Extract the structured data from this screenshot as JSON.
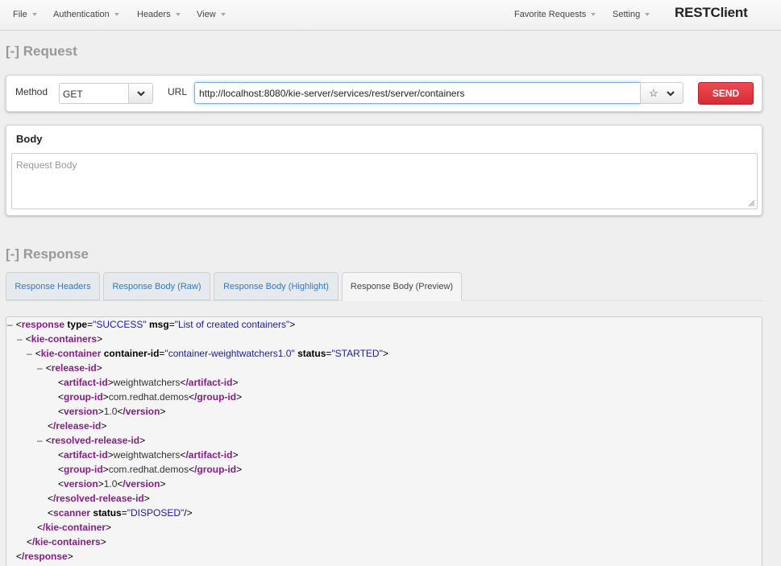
{
  "navbar": {
    "file": "File",
    "authentication": "Authentication",
    "headers": "Headers",
    "view": "View",
    "favorite_requests": "Favorite Requests",
    "setting": "Setting",
    "brand": "RESTClient"
  },
  "request": {
    "section_title": "[-] Request",
    "method_label": "Method",
    "method_value": "GET",
    "url_label": "URL",
    "url_value": "http://localhost:8080/kie-server/services/rest/server/containers",
    "send_label": "SEND",
    "star_icon": "star-icon",
    "body_title": "Body",
    "body_placeholder": "Request Body"
  },
  "response": {
    "section_title": "[-] Response",
    "tabs": [
      {
        "label": "Response Headers",
        "active": false
      },
      {
        "label": "Response Body (Raw)",
        "active": false
      },
      {
        "label": "Response Body (Highlight)",
        "active": false
      },
      {
        "label": "Response Body (Preview)",
        "active": true
      }
    ],
    "xml": {
      "toggle": "–",
      "response_tag": "response",
      "response_close": "/response",
      "type_attr": "type",
      "type_val": "\"SUCCESS\"",
      "msg_attr": "msg",
      "msg_val": "\"List of created containers\"",
      "kie_containers": "kie-containers",
      "kie_containers_close": "/kie-containers",
      "kie_container": "kie-container",
      "kie_container_close": "/kie-container",
      "container_id_attr": "container-id",
      "container_id_val": "\"container-weightwatchers1.0\"",
      "status_attr": "status",
      "status_val": "\"STARTED\"",
      "release_id": "release-id",
      "release_id_close": "/release-id",
      "resolved_release_id": "resolved-release-id",
      "resolved_release_id_close": "/resolved-release-id",
      "artifact_id": "artifact-id",
      "artifact_id_close": "/artifact-id",
      "artifact_value": "weightwatchers",
      "group_id": "group-id",
      "group_id_close": "/group-id",
      "group_value": "com.redhat.demos",
      "version": "version",
      "version_close": "/version",
      "version_value": "1.0",
      "scanner": "scanner",
      "scanner_status_val": "\"DISPOSED\""
    }
  }
}
